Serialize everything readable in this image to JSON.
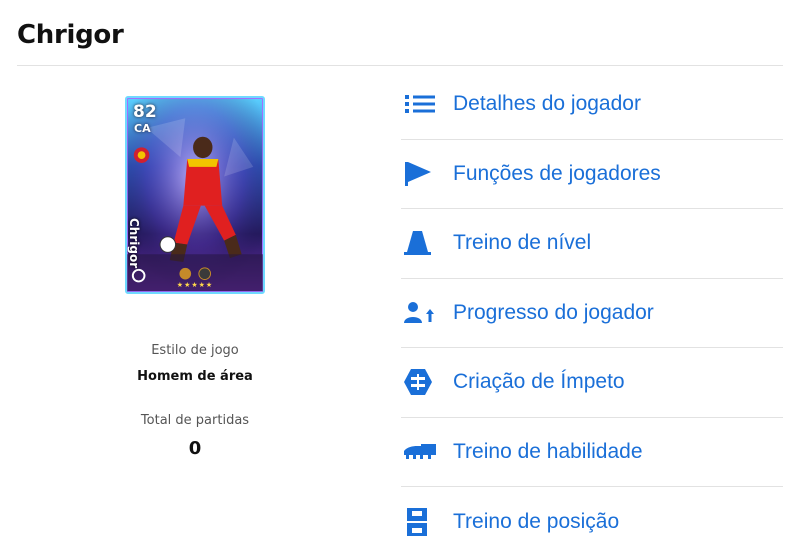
{
  "header": {
    "title": "Chrigor"
  },
  "card": {
    "rating": "82",
    "position": "CA",
    "name": "Chrigor",
    "stars": "★★★★★"
  },
  "info": {
    "style_label": "Estilo de jogo",
    "style_value": "Homem de área",
    "matches_label": "Total de partidas",
    "matches_value": "0"
  },
  "menu": {
    "items": [
      {
        "label": "Detalhes do jogador",
        "icon": "list-icon"
      },
      {
        "label": "Funções de jogadores",
        "icon": "flag-icon"
      },
      {
        "label": "Treino de nível",
        "icon": "cone-icon"
      },
      {
        "label": "Progresso do jogador",
        "icon": "person-up-icon"
      },
      {
        "label": "Criação de Ímpeto",
        "icon": "momentum-icon"
      },
      {
        "label": "Treino de habilidade",
        "icon": "boot-icon"
      },
      {
        "label": "Treino de posição",
        "icon": "pitch-icon"
      }
    ]
  },
  "colors": {
    "accent": "#1a6fd8",
    "divider": "#e2e2e2",
    "text": "#111111",
    "muted": "#555555"
  }
}
